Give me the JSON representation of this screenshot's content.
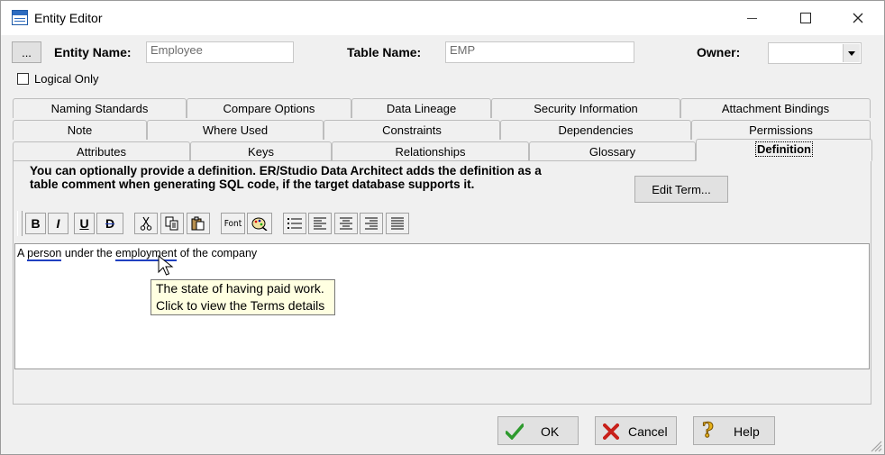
{
  "window": {
    "title": "Entity Editor"
  },
  "header": {
    "ellipsis_label": "...",
    "entity_name_label": "Entity Name:",
    "entity_name_value": "Employee",
    "table_name_label": "Table Name:",
    "table_name_value": "EMP",
    "owner_label": "Owner:",
    "owner_value": "",
    "logical_only_label": "Logical Only",
    "logical_only_checked": false
  },
  "tabs": {
    "row1": [
      "Naming Standards",
      "Compare Options",
      "Data Lineage",
      "Security Information",
      "Attachment Bindings"
    ],
    "row2": [
      "Note",
      "Where Used",
      "Constraints",
      "Dependencies",
      "Permissions"
    ],
    "row3": [
      "Attributes",
      "Keys",
      "Relationships",
      "Glossary",
      "Definition"
    ],
    "active": "Definition"
  },
  "definition": {
    "instructions_line1": "You can optionally provide a definition.  ER/Studio Data Architect adds the definition as a",
    "instructions_line2": "table comment when generating SQL code, if the target database supports it.",
    "edit_term_label": "Edit Term...",
    "toolbar": {
      "bold": "B",
      "italic": "I",
      "underline": "U",
      "strike": "D",
      "font": "Font"
    },
    "text": {
      "part1": "A ",
      "term1": "person",
      "part2": " under the ",
      "term2": "employment",
      "part3": " of the company"
    },
    "tooltip_line1": "The state of having paid work.",
    "tooltip_line2": "Click to view the Terms details"
  },
  "footer": {
    "ok_label": "OK",
    "cancel_label": "Cancel",
    "help_label": "Help"
  }
}
